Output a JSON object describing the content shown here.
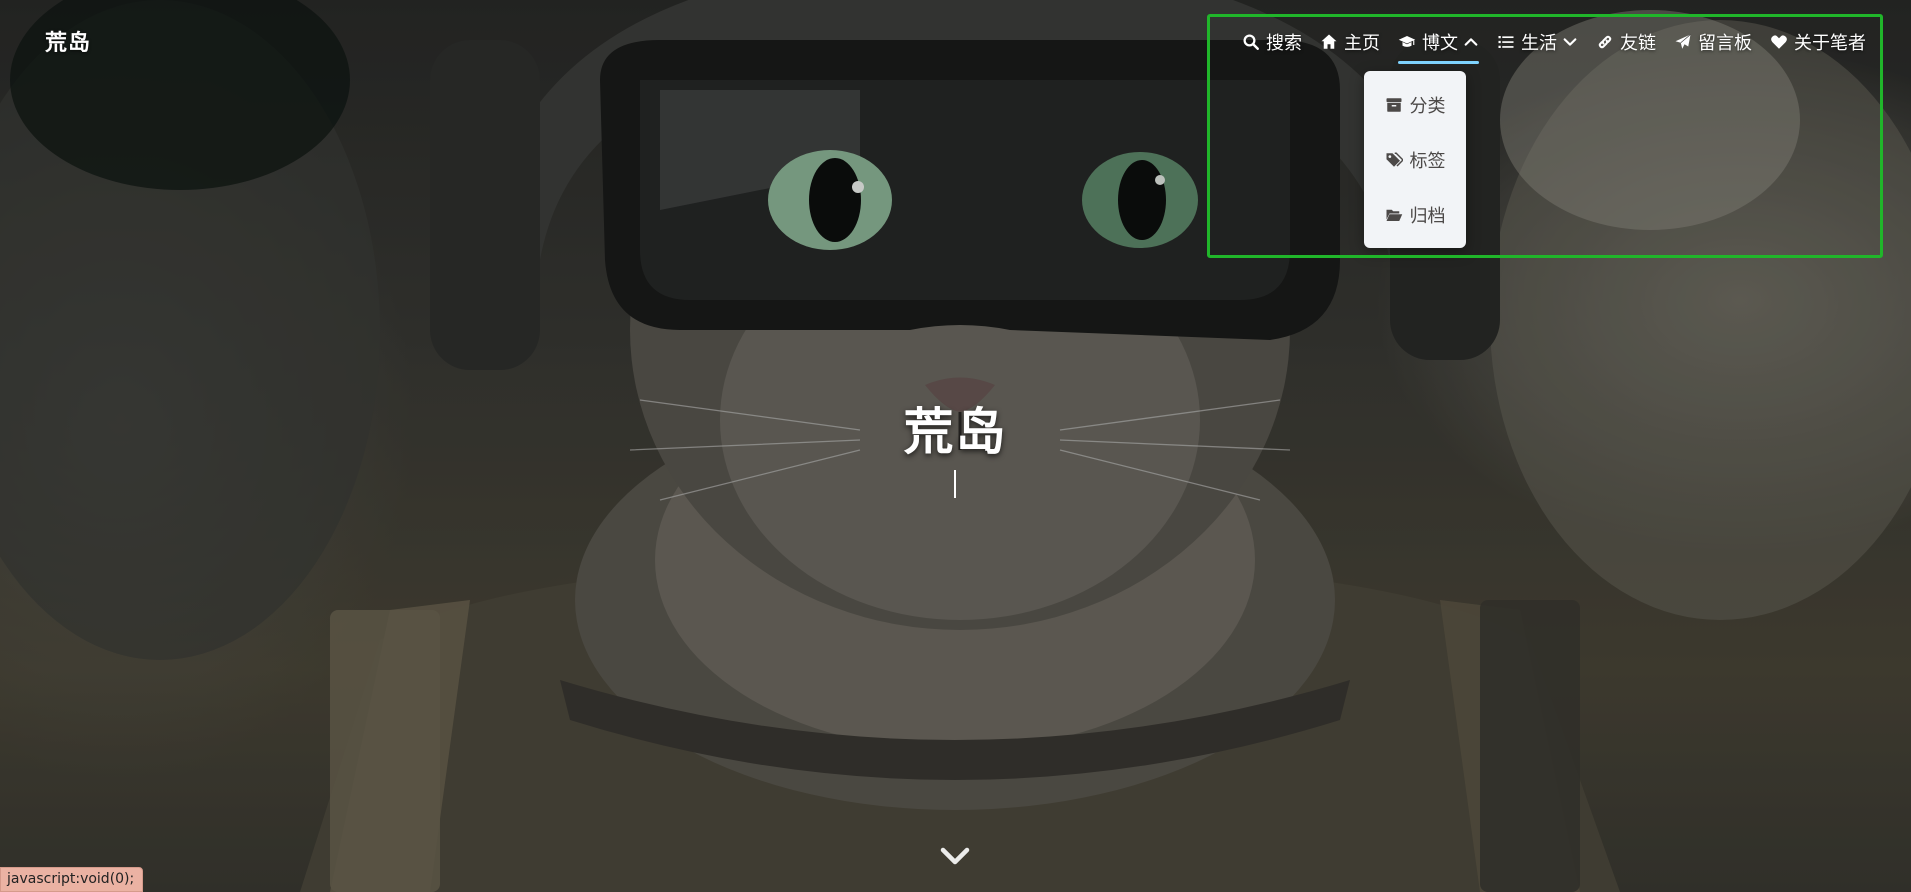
{
  "brand": "荒岛",
  "nav": {
    "items": [
      {
        "label": "搜索",
        "icon": "search-icon",
        "dropdown": false
      },
      {
        "label": "主页",
        "icon": "home-icon",
        "dropdown": false
      },
      {
        "label": "博文",
        "icon": "graduation-cap-icon",
        "dropdown": true,
        "expanded": true
      },
      {
        "label": "生活",
        "icon": "list-icon",
        "dropdown": true,
        "expanded": false
      },
      {
        "label": "友链",
        "icon": "link-icon",
        "dropdown": false
      },
      {
        "label": "留言板",
        "icon": "paper-plane-icon",
        "dropdown": false
      },
      {
        "label": "关于笔者",
        "icon": "heart-icon",
        "dropdown": false
      }
    ],
    "dropdown_items": [
      {
        "label": "分类",
        "icon": "archive-box-icon"
      },
      {
        "label": "标签",
        "icon": "tags-icon"
      },
      {
        "label": "归档",
        "icon": "folder-open-icon"
      }
    ]
  },
  "hero": {
    "title": "荒岛",
    "subtitle": ""
  },
  "status_bar": "javascript:void(0);",
  "colors": {
    "highlight_border": "#20b62a",
    "active_underline": "#7fd4ff",
    "dropdown_bg": "#f2f4f7",
    "dropdown_text": "#4c4948",
    "status_bg": "#ebb2a3"
  }
}
